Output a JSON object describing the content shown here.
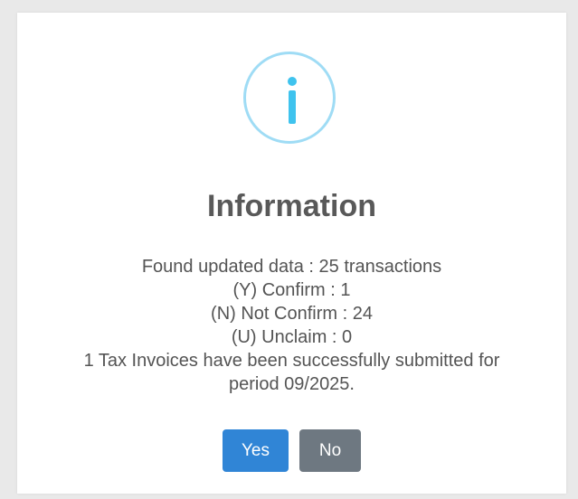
{
  "dialog": {
    "icon": "info-icon",
    "title": "Information",
    "message_lines": [
      "Found updated data : 25 transactions",
      "(Y) Confirm : 1",
      "(N) Not Confirm : 24",
      "(U) Unclaim : 0",
      "1 Tax Invoices have been successfully submitted for",
      "period 09/2025."
    ],
    "buttons": {
      "yes_label": "Yes",
      "no_label": "No"
    }
  },
  "colors": {
    "icon_ring": "#9fdcf5",
    "icon_fill": "#3fc3ee",
    "yes_button": "#3085d6",
    "no_button": "#6e7881",
    "title_text": "#595959"
  }
}
